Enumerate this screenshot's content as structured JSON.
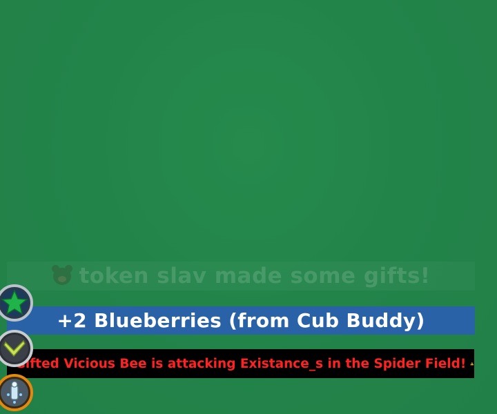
{
  "notifications": {
    "faded_message": "token slav made some gifts!",
    "reward_message": "+2 Blueberries (from Cub Buddy)",
    "alert_message": "Gifted Vicious Bee is attacking Existance_s in the Spider Field!"
  },
  "icons": {
    "faded_banner": "bear-face-icon",
    "alert_left": "warning-icon",
    "alert_right": "warning-icon",
    "side_buttons": [
      "star-badge-icon",
      "boomerang-badge-icon",
      "sprinkler-badge-icon"
    ]
  },
  "colors": {
    "background": "#24854a",
    "reward_banner": "#2a62a8",
    "alert_background": "#000000",
    "alert_text": "#ff2222",
    "warning_yellow": "#f5c518"
  }
}
